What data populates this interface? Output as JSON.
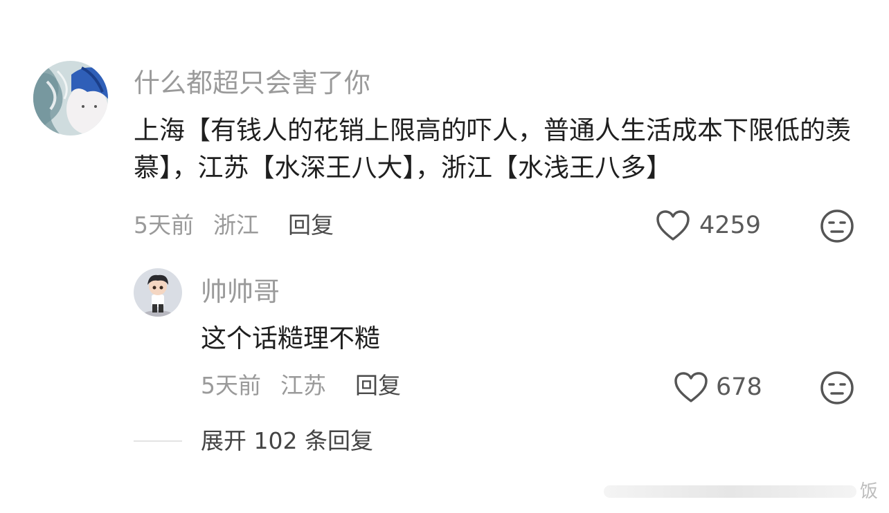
{
  "comments": [
    {
      "username": "什么都超只会害了你",
      "text": "上海【有钱人的花销上限高的吓人，普通人生活成本下限低的羡慕】，江苏【水深王八大】，浙江【水浅王八多】",
      "time": "5天前",
      "location": "浙江",
      "reply_label": "回复",
      "likes": "4259"
    }
  ],
  "replies": [
    {
      "username": "帅帅哥",
      "text": "这个话糙理不糙",
      "time": "5天前",
      "location": "江苏",
      "reply_label": "回复",
      "likes": "678"
    }
  ],
  "expand_label": "展开 102 条回复",
  "watermark": "饭",
  "icons": {
    "like": "heart-outline-icon",
    "dislike": "neutral-face-icon"
  },
  "colors": {
    "username": "#9a9a9a",
    "text": "#1f1f1f",
    "meta": "#9a9a9a"
  }
}
